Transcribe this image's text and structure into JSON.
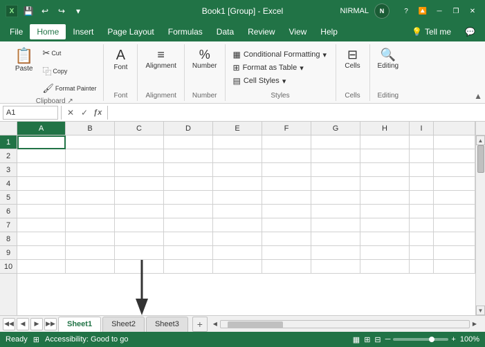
{
  "titlebar": {
    "title": "Book1 [Group] - Excel",
    "user": "NIRMAL",
    "user_initial": "N",
    "save_label": "💾",
    "undo_label": "↩",
    "redo_label": "↪",
    "customize_label": "▾",
    "minimize_label": "─",
    "restore_label": "❐",
    "close_label": "✕"
  },
  "menu": {
    "items": [
      "File",
      "Home",
      "Insert",
      "Page Layout",
      "Formulas",
      "Data",
      "Review",
      "View",
      "Help"
    ],
    "active": "Home",
    "tell_me": "Tell me",
    "help_icon": "💡",
    "comment_icon": "💬"
  },
  "ribbon": {
    "clipboard_label": "Clipboard",
    "clipboard_expander": "⌄",
    "paste_label": "Paste",
    "cut_label": "Cut",
    "cut_icon": "✂",
    "copy_label": "Copy",
    "copy_icon": "⿻",
    "format_painter_label": "Format Painter",
    "format_painter_icon": "🖌",
    "font_label": "Font",
    "alignment_label": "Alignment",
    "number_label": "Number",
    "styles_label": "Styles",
    "conditional_formatting": "Conditional Formatting",
    "format_table": "Format as Table",
    "cell_styles": "Cell Styles",
    "cells_label": "Cells",
    "editing_label": "Editing",
    "collapse_icon": "▲"
  },
  "formula_bar": {
    "name_box": "A1",
    "cancel_btn": "✕",
    "confirm_btn": "✓",
    "formula_icon": "ƒx",
    "formula_content": ""
  },
  "spreadsheet": {
    "columns": [
      "A",
      "B",
      "C",
      "D",
      "E",
      "F",
      "G",
      "H",
      "I"
    ],
    "rows": [
      1,
      2,
      3,
      4,
      5,
      6,
      7,
      8,
      9,
      10
    ],
    "selected_cell": "A1",
    "selected_col": "A",
    "selected_row": 1
  },
  "sheet_tabs": {
    "tabs": [
      "Sheet1",
      "Sheet2",
      "Sheet3"
    ],
    "active_tab": "Sheet1",
    "add_icon": "+"
  },
  "status_bar": {
    "ready_label": "Ready",
    "accessibility_label": "Accessibility: Good to go",
    "page_layout_icon": "⊞",
    "normal_view_icon": "▦",
    "page_break_icon": "⊟",
    "zoom_percent": "100%"
  }
}
